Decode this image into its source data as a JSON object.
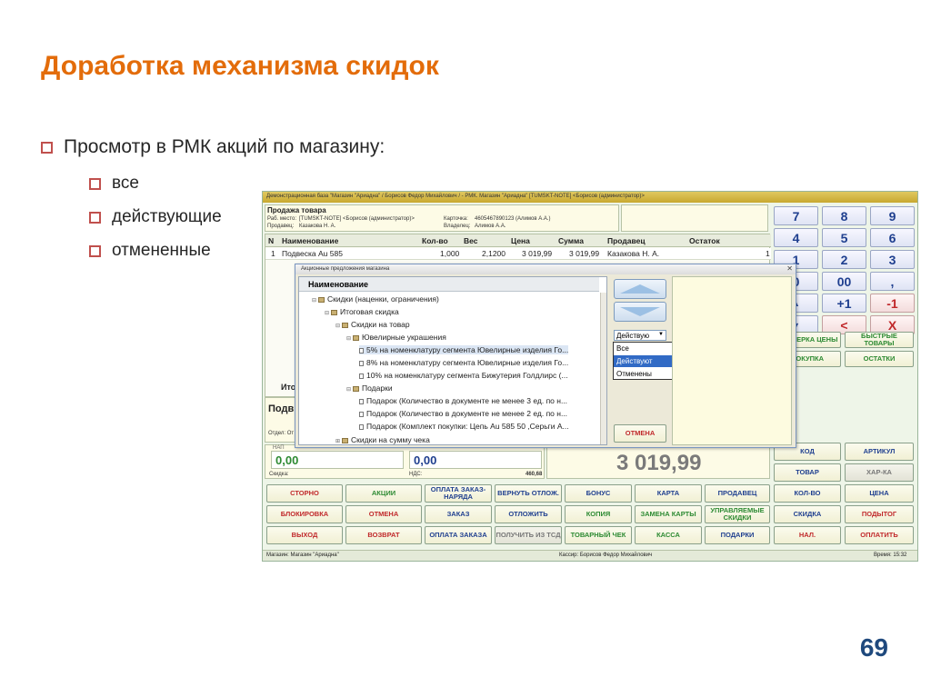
{
  "slide": {
    "title": "Доработка механизма скидок",
    "bullet_main": "Просмотр в РМК акций по магазину:",
    "sub_bullets": [
      "все",
      "действующие",
      "отмененные"
    ],
    "page_number": "69"
  },
  "app": {
    "window_title": "Демонстрационная база \"Магазин \"Ариадна\" / Борисов Федор Михайлович / - РМК. Магазин \"Ариадна\" [TUMSKT-NOTE] <Борисов (администратор)>",
    "header": {
      "mode": "Продажа товара",
      "workplace_label": "Раб. место:",
      "workplace_value": "[TUMSKT-NOTE] <Борисов (администратор)>",
      "seller_label": "Продавец:",
      "seller_value": "Казакова Н. А.",
      "card_label": "Карточка:",
      "card_value": "4605467890123 (Алимов А.А.)",
      "owner_label": "Владелец:",
      "owner_value": "Алимов А.А."
    },
    "table": {
      "columns": [
        "N",
        "Наименование",
        "Кол-во",
        "Вес",
        "Цена",
        "Сумма",
        "Продавец",
        "Остаток"
      ],
      "rows": [
        [
          "1",
          "Подвеска Au 585",
          "1,000",
          "2,1200",
          "3 019,99",
          "3 019,99",
          "Казакова Н. А.",
          "1"
        ]
      ]
    },
    "left_labels": {
      "total_stub": "Ито",
      "item_stub": "Подв",
      "dept_stub": "Отдел: От",
      "nap_label": "НАП",
      "cash_value": "0,00",
      "card_value": "0,00",
      "discount_label": "Скидка:",
      "vat_label": "НДС:",
      "vat_value": "460,68"
    },
    "total_amount": "3 019,99",
    "keypad": [
      "7",
      "8",
      "9",
      "4",
      "5",
      "6",
      "1",
      "2",
      "3",
      "0",
      "00",
      ",",
      "▲",
      "+1",
      "-1",
      "▼",
      "<",
      "X"
    ],
    "side_buttons": [
      "ПРОВЕРКА ЦЕНЫ",
      "БЫСТРЫЕ ТОВАРЫ",
      "ПОКУПКА",
      "ОСТАТКИ",
      "КОД",
      "АРТИКУЛ",
      "ТОВАР",
      "ХАР-КА",
      "КОЛ-ВО",
      "ЦЕНА",
      "СКИДКА",
      "ПОДЫТОГ",
      "НАЛ.",
      "ОПЛАТИТЬ"
    ],
    "bottom_buttons": {
      "row1": [
        "СТОРНО",
        "АКЦИИ",
        "ОПЛАТА ЗАКАЗ-НАРЯДА",
        "ВЕРНУТЬ ОТЛОЖ.",
        "БОНУС",
        "КАРТА",
        "ПРОДАВЕЦ"
      ],
      "row2": [
        "БЛОКИРОВКА",
        "ОТМЕНА",
        "ЗАКАЗ",
        "ОТЛОЖИТЬ",
        "КОПИЯ",
        "ЗАМЕНА КАРТЫ",
        "УПРАВЛЯЕМЫЕ СКИДКИ"
      ],
      "row3": [
        "ВЫХОД",
        "ВОЗВРАТ",
        "ОПЛАТА ЗАКАЗА",
        "ПОЛУЧИТЬ ИЗ ТСД",
        "ТОВАРНЫЙ ЧЕК",
        "КАССА",
        "ПОДАРКИ"
      ]
    },
    "status_bar": {
      "shop": "Магазин: Магазин \"Ариадна\"",
      "cashier": "Кассир: Борисов Федор Михайлович",
      "time": "Время: 15:32"
    },
    "colors": {
      "red_text": "#c0282a",
      "blue_text": "#1f3f8f",
      "green_text": "#2d8a32",
      "panel_bg": "#fdfbe6"
    }
  },
  "dialog": {
    "title": "Акционные предложения магазина",
    "tree_header": "Наименование",
    "tree": [
      "Скидки (наценки, ограничения)",
      "Итоговая скидка",
      "Скидки на товар",
      "Ювелирные украшения",
      "5% на номенклатуру сегмента Ювелирные изделия Го...",
      "8% на номенклатуру сегмента Ювелирные изделия Го...",
      "10% на номенклатуру сегмента Бижутерия Голдлирс (...",
      "Подарки",
      "Подарок (Количество в документе не менее 3 ед. по н...",
      "Подарок (Количество в документе не менее 2 ед. по н...",
      "Подарок (Комплект покупки: Цепь Au 585 50 ,Серьги А...",
      "Скидки на сумму чека"
    ],
    "filter_selected": "Действую",
    "filter_options": [
      "Все",
      "Действуют",
      "Отменены"
    ],
    "cancel_button": "ОТМЕНА"
  }
}
